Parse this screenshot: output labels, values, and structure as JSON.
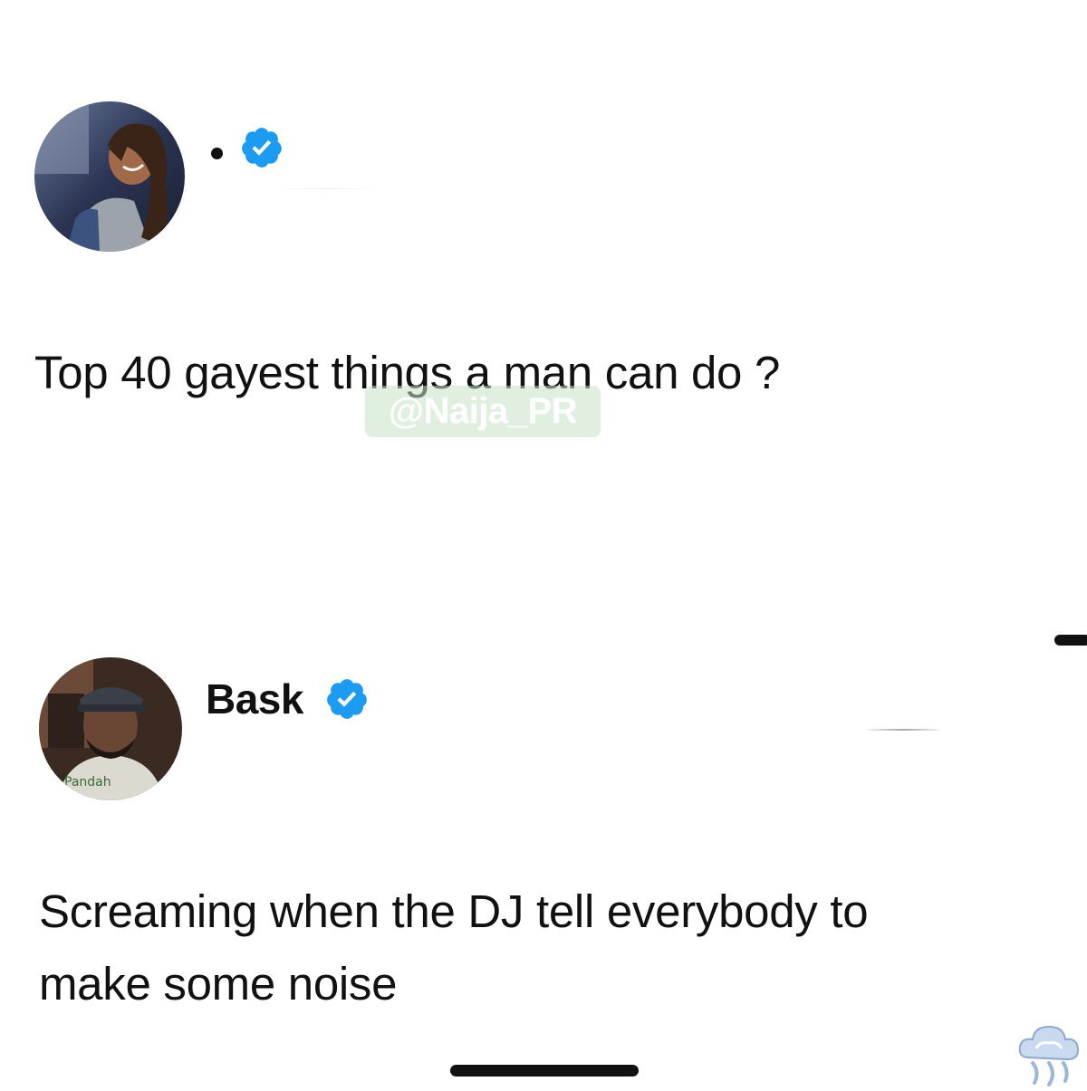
{
  "watermark": {
    "text": "@Naija_PR"
  },
  "original_tweet": {
    "display_name": "•",
    "verified": true,
    "text": "Top 40 gayest things a man can do ?"
  },
  "reply_tweet": {
    "display_name": "Bask",
    "verified": true,
    "text_line1": "Screaming when the DJ tell everybody to",
    "text_line2": "make some noise"
  },
  "colors": {
    "verified_badge": "#1d9bf0",
    "text": "#111111",
    "background": "#ffffff"
  },
  "icons": {
    "verified": "verified-badge-icon",
    "logo": "cloud-logo-icon"
  }
}
